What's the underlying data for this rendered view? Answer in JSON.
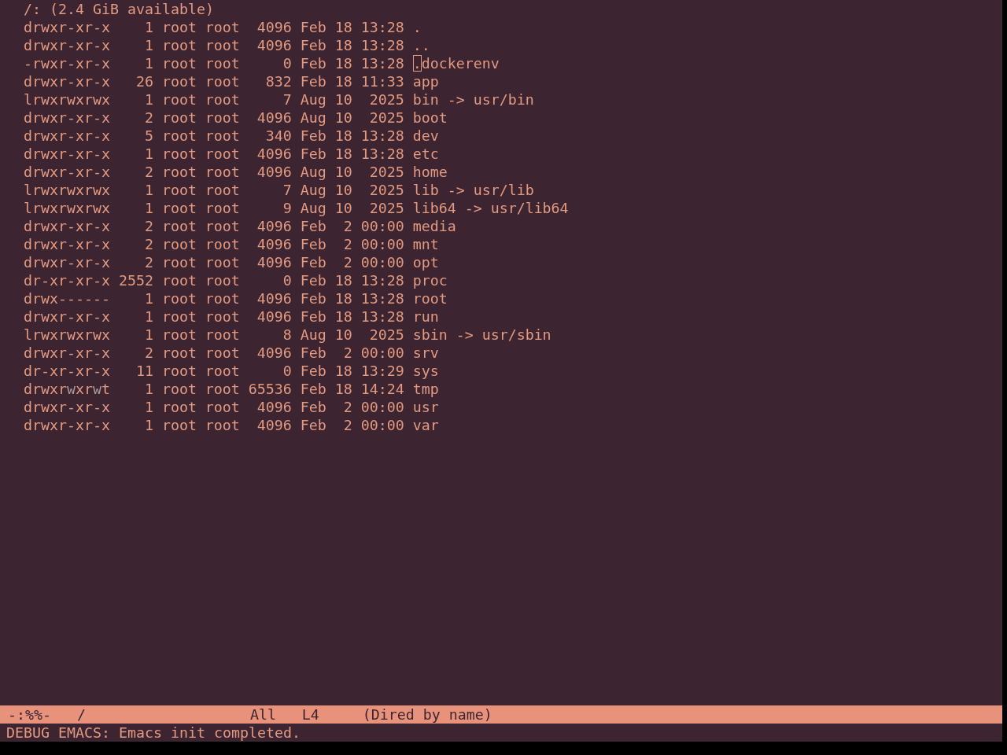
{
  "header": "/: (2.4 GiB available)",
  "entries": [
    {
      "permissions": "drwxr-xr-x",
      "links": "1",
      "owner": "root",
      "group": "root",
      "size": "4096",
      "month": "Feb",
      "day": "18",
      "time": "13:28",
      "name": ".",
      "cursor": false,
      "write_highlight": false
    },
    {
      "permissions": "drwxr-xr-x",
      "links": "1",
      "owner": "root",
      "group": "root",
      "size": "4096",
      "month": "Feb",
      "day": "18",
      "time": "13:28",
      "name": "..",
      "cursor": false,
      "write_highlight": false
    },
    {
      "permissions": "-rwxr-xr-x",
      "links": "1",
      "owner": "root",
      "group": "root",
      "size": "0",
      "month": "Feb",
      "day": "18",
      "time": "13:28",
      "name": ".dockerenv",
      "cursor": true,
      "write_highlight": false
    },
    {
      "permissions": "drwxr-xr-x",
      "links": "26",
      "owner": "root",
      "group": "root",
      "size": "832",
      "month": "Feb",
      "day": "18",
      "time": "11:33",
      "name": "app",
      "cursor": false,
      "write_highlight": false
    },
    {
      "permissions": "lrwxrwxrwx",
      "links": "1",
      "owner": "root",
      "group": "root",
      "size": "7",
      "month": "Aug",
      "day": "10",
      "time": "2025",
      "name": "bin -> usr/bin",
      "cursor": false,
      "write_highlight": false
    },
    {
      "permissions": "drwxr-xr-x",
      "links": "2",
      "owner": "root",
      "group": "root",
      "size": "4096",
      "month": "Aug",
      "day": "10",
      "time": "2025",
      "name": "boot",
      "cursor": false,
      "write_highlight": false
    },
    {
      "permissions": "drwxr-xr-x",
      "links": "5",
      "owner": "root",
      "group": "root",
      "size": "340",
      "month": "Feb",
      "day": "18",
      "time": "13:28",
      "name": "dev",
      "cursor": false,
      "write_highlight": false
    },
    {
      "permissions": "drwxr-xr-x",
      "links": "1",
      "owner": "root",
      "group": "root",
      "size": "4096",
      "month": "Feb",
      "day": "18",
      "time": "13:28",
      "name": "etc",
      "cursor": false,
      "write_highlight": false
    },
    {
      "permissions": "drwxr-xr-x",
      "links": "2",
      "owner": "root",
      "group": "root",
      "size": "4096",
      "month": "Aug",
      "day": "10",
      "time": "2025",
      "name": "home",
      "cursor": false,
      "write_highlight": false
    },
    {
      "permissions": "lrwxrwxrwx",
      "links": "1",
      "owner": "root",
      "group": "root",
      "size": "7",
      "month": "Aug",
      "day": "10",
      "time": "2025",
      "name": "lib -> usr/lib",
      "cursor": false,
      "write_highlight": false
    },
    {
      "permissions": "lrwxrwxrwx",
      "links": "1",
      "owner": "root",
      "group": "root",
      "size": "9",
      "month": "Aug",
      "day": "10",
      "time": "2025",
      "name": "lib64 -> usr/lib64",
      "cursor": false,
      "write_highlight": false
    },
    {
      "permissions": "drwxr-xr-x",
      "links": "2",
      "owner": "root",
      "group": "root",
      "size": "4096",
      "month": "Feb",
      "day": "2",
      "time": "00:00",
      "name": "media",
      "cursor": false,
      "write_highlight": false
    },
    {
      "permissions": "drwxr-xr-x",
      "links": "2",
      "owner": "root",
      "group": "root",
      "size": "4096",
      "month": "Feb",
      "day": "2",
      "time": "00:00",
      "name": "mnt",
      "cursor": false,
      "write_highlight": false
    },
    {
      "permissions": "drwxr-xr-x",
      "links": "2",
      "owner": "root",
      "group": "root",
      "size": "4096",
      "month": "Feb",
      "day": "2",
      "time": "00:00",
      "name": "opt",
      "cursor": false,
      "write_highlight": false
    },
    {
      "permissions": "dr-xr-xr-x",
      "links": "2552",
      "owner": "root",
      "group": "root",
      "size": "0",
      "month": "Feb",
      "day": "18",
      "time": "13:28",
      "name": "proc",
      "cursor": false,
      "write_highlight": false
    },
    {
      "permissions": "drwx------",
      "links": "1",
      "owner": "root",
      "group": "root",
      "size": "4096",
      "month": "Feb",
      "day": "18",
      "time": "13:28",
      "name": "root",
      "cursor": false,
      "write_highlight": false
    },
    {
      "permissions": "drwxr-xr-x",
      "links": "1",
      "owner": "root",
      "group": "root",
      "size": "4096",
      "month": "Feb",
      "day": "18",
      "time": "13:28",
      "name": "run",
      "cursor": false,
      "write_highlight": false
    },
    {
      "permissions": "lrwxrwxrwx",
      "links": "1",
      "owner": "root",
      "group": "root",
      "size": "8",
      "month": "Aug",
      "day": "10",
      "time": "2025",
      "name": "sbin -> usr/sbin",
      "cursor": false,
      "write_highlight": false
    },
    {
      "permissions": "drwxr-xr-x",
      "links": "2",
      "owner": "root",
      "group": "root",
      "size": "4096",
      "month": "Feb",
      "day": "2",
      "time": "00:00",
      "name": "srv",
      "cursor": false,
      "write_highlight": false
    },
    {
      "permissions": "dr-xr-xr-x",
      "links": "11",
      "owner": "root",
      "group": "root",
      "size": "0",
      "month": "Feb",
      "day": "18",
      "time": "13:29",
      "name": "sys",
      "cursor": false,
      "write_highlight": false
    },
    {
      "permissions": "drwxrwxrwt",
      "links": "1",
      "owner": "root",
      "group": "root",
      "size": "65536",
      "month": "Feb",
      "day": "18",
      "time": "14:24",
      "name": "tmp",
      "cursor": false,
      "write_highlight": true
    },
    {
      "permissions": "drwxr-xr-x",
      "links": "1",
      "owner": "root",
      "group": "root",
      "size": "4096",
      "month": "Feb",
      "day": "2",
      "time": "00:00",
      "name": "usr",
      "cursor": false,
      "write_highlight": false
    },
    {
      "permissions": "drwxr-xr-x",
      "links": "1",
      "owner": "root",
      "group": "root",
      "size": "4096",
      "month": "Feb",
      "day": "2",
      "time": "00:00",
      "name": "var",
      "cursor": false,
      "write_highlight": false
    }
  ],
  "mode_line": {
    "status": "-:%%-",
    "buffer": "/",
    "position": "All",
    "line": "L4",
    "mode": "(Dired by name)"
  },
  "echo_area": "DEBUG EMACS: Emacs init completed."
}
